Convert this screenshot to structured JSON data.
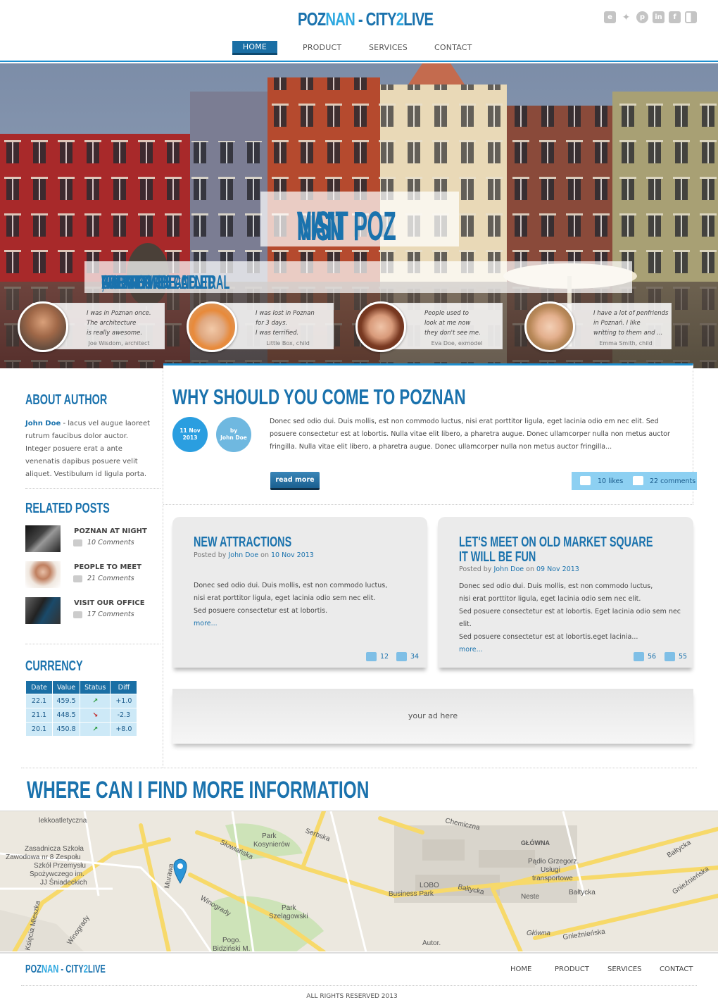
{
  "header": {
    "logo_part1": "POZ",
    "logo_part2": "NAN",
    "logo_part3": " - CITY",
    "logo_part4": "2",
    "logo_part5": "LIVE",
    "social_icons": [
      "evernote-icon",
      "twitter-icon",
      "pinterest-icon",
      "linkedin-icon",
      "facebook-icon",
      "delicious-icon"
    ]
  },
  "nav": [
    {
      "label": "HOME",
      "active": true
    },
    {
      "label": "PRODUCT"
    },
    {
      "label": "SERVICES"
    },
    {
      "label": "CONTACT"
    }
  ],
  "hero": {
    "title_part1": "VISIT POZ",
    "title_part2": "NAN",
    "subtitle_1": "A CITY ON THE ",
    "subtitle_2": "WARTA",
    "subtitle_3": " RIVER IN WEST-CENTRAL ",
    "subtitle_4": "POLAND",
    "subtitle_5": ", THE REGION CALLED ",
    "subtitle_6": "GREATER POLAND."
  },
  "testimonials": [
    {
      "text": "I was in Poznan once.\nThe architecture\nis really awesome.",
      "by": "Joe Wisdom, architect"
    },
    {
      "text": "I was lost in Poznan\nfor 3 days.\nI was terrified.",
      "by": "Little Box, child"
    },
    {
      "text": "People used to\nlook at me now\nthey don't see me.",
      "by": "Eva Doe, exmodel"
    },
    {
      "text": "I have a lot of penfriends\nin Poznań. I like\nwritting to them and ...",
      "by": "Emma Smith, child"
    }
  ],
  "sidebar": {
    "about_title": "ABOUT AUTHOR",
    "about_name": "John Doe",
    "about_text": " - lacus vel augue laoreet rutrum faucibus dolor auctor. Integer posuere erat a ante venenatis dapibus posuere velit aliquet. Vestibulum id ligula porta.",
    "related_title": "RELATED POSTS",
    "related": [
      {
        "title": "POZNAN AT NIGHT",
        "comments": "10 Comments"
      },
      {
        "title": "PEOPLE TO MEET",
        "comments": "21 Comments"
      },
      {
        "title": "VISIT OUR OFFICE",
        "comments": "17 Comments"
      }
    ],
    "currency_title": "CURRENCY",
    "currency_headers": [
      "Date",
      "Value",
      "Status",
      "Diff"
    ],
    "currency_rows": [
      {
        "date": "22.1",
        "value": "459.5",
        "status": "up",
        "diff": "+1.0"
      },
      {
        "date": "21.1",
        "value": "448.5",
        "status": "down",
        "diff": "-2.3"
      },
      {
        "date": "20.1",
        "value": "450.8",
        "status": "up",
        "diff": "+8.0"
      }
    ]
  },
  "article": {
    "title": "WHY SHOULD YOU COME TO POZNAN",
    "date_line1": "11 Nov",
    "date_line2": "2013",
    "by_line1": "by",
    "by_line2": "John Doe",
    "text": "Donec sed odio dui. Duis mollis, est non commodo luctus, nisi erat porttitor ligula, eget lacinia odio  em nec elit. Sed posuere consectetur est at lobortis. Nulla vitae elit libero, a pharetra augue. Donec  ullamcorper nulla non metus auctor fringilla. Nulla vitae elit libero, a pharetra augue. Donec  ullamcorper nulla non metus auctor fringilla...",
    "read_more": "read more",
    "likes": "10 likes",
    "comments": "22 comments"
  },
  "cards": [
    {
      "title": "NEW ATTRACTIONS",
      "posted": "Posted by ",
      "author": "John Doe",
      "on": " on ",
      "date": "10 Nov 2013",
      "body": "Donec sed odio dui. Duis mollis, est non commodo luctus,\nnisi erat porttitor ligula, eget lacinia odio sem nec elit.\nSed posuere consectetur est at lobortis.",
      "more": "more...",
      "likes": "12",
      "comments": "34"
    },
    {
      "title": "LET'S MEET ON OLD MARKET SQUARE\nIT WILL BE FUN",
      "posted": "Posted by ",
      "author": "John Doe",
      "on": " on ",
      "date": "09 Nov 2013",
      "body": "Donec sed odio dui. Duis mollis, est non commodo luctus,\nnisi erat porttitor ligula, eget lacinia odio sem nec elit.\nSed posuere consectetur est at lobortis. Eget lacinia odio sem nec elit.\nSed posuere consectetur est at lobortis.eget lacinia...",
      "more": "more...",
      "likes": "56",
      "comments": "55"
    }
  ],
  "ad": {
    "text": "your ad here"
  },
  "info": {
    "title": "WHERE CAN I FIND MORE INFORMATION"
  },
  "map": {
    "labels": [
      "lekkoatletyczna",
      "Zasadnicza Szkoła",
      "Zawodowa nr 8 Zespołu",
      "Szkół Przemysłu",
      "Spożywczego im.",
      "JJ Śniadeckich",
      "Serbska",
      "Chemiczna",
      "Park",
      "Kosynierów",
      "Słowiańska",
      "GŁÓWNA",
      "Pądło Grzegorz.",
      "Usługi",
      "transportowe",
      "Murawa",
      "Winogrady",
      "LOBO",
      "Business Park",
      "Bałtycka",
      "Neste",
      "Bałtycka",
      "Gnieźnieńska",
      "Park",
      "Szelągowski",
      "Księcia Mieszka",
      "Winogrady",
      "Pogo.",
      "Bidziński M.",
      "Autor.",
      "Główna",
      "Gnieźnieńska",
      "Bałtycka"
    ]
  },
  "footer": {
    "logo_part1": "POZ",
    "logo_part2": "NAN",
    "logo_part3": " - CITY",
    "logo_part4": "2",
    "logo_part5": "LIVE",
    "nav": [
      "HOME",
      "PRODUCT",
      "SERVICES",
      "CONTACT"
    ],
    "copyright": "ALL RIGHTS RESERVED 2013"
  }
}
